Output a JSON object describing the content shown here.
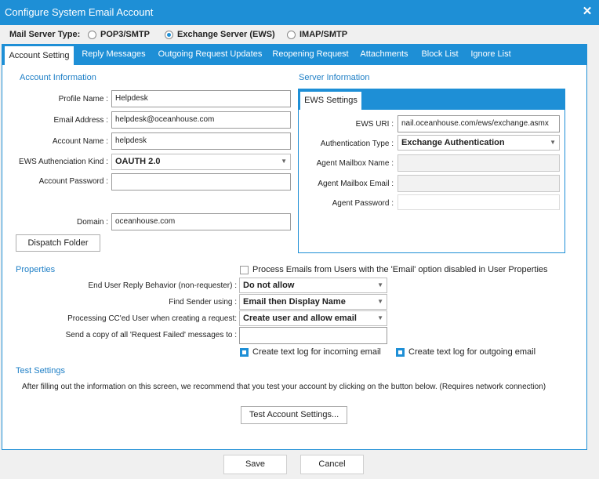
{
  "window": {
    "title": "Configure System Email Account"
  },
  "mail_server": {
    "label": "Mail Server Type:",
    "options": [
      "POP3/SMTP",
      "Exchange Server (EWS)",
      "IMAP/SMTP"
    ],
    "selected": "Exchange Server (EWS)"
  },
  "tabs": [
    "Account Setting",
    "Reply Messages",
    "Outgoing Request Updates",
    "Reopening Request",
    "Attachments",
    "Block List",
    "Ignore List"
  ],
  "account_info": {
    "heading": "Account Information",
    "profile_name_label": "Profile Name :",
    "profile_name": "Helpdesk",
    "email_label": "Email Address :",
    "email": "helpdesk@oceanhouse.com",
    "account_name_label": "Account Name :",
    "account_name": "helpdesk",
    "ews_auth_kind_label": "EWS Authenciation Kind :",
    "ews_auth_kind": "OAUTH 2.0",
    "password_label": "Account Password :",
    "password": "",
    "domain_label": "Domain :",
    "domain": "oceanhouse.com",
    "dispatch_button": "Dispatch Folder"
  },
  "server_info": {
    "heading": "Server Information",
    "tab": "EWS Settings",
    "ews_uri_label": "EWS URI :",
    "ews_uri": "nail.oceanhouse.com/ews/exchange.asmx",
    "auth_type_label": "Authentication Type :",
    "auth_type": "Exchange Authentication",
    "agent_mailbox_name_label": "Agent Mailbox Name :",
    "agent_mailbox_email_label": "Agent Mailbox Email :",
    "agent_password_label": "Agent Password :"
  },
  "properties": {
    "heading": "Properties",
    "process_emails_label": "Process Emails from Users with the 'Email' option disabled in User Properties",
    "reply_behavior_label": "End User Reply Behavior (non-requester) :",
    "reply_behavior": "Do not allow",
    "find_sender_label": "Find Sender using :",
    "find_sender": "Email then Display Name",
    "cc_user_label": "Processing CC'ed User when creating a request:",
    "cc_user": "Create user and allow email",
    "copy_failed_label": "Send a copy of all 'Request Failed' messages to :",
    "copy_failed": "",
    "log_incoming_label": "Create text log for incoming email",
    "log_outgoing_label": "Create text log for outgoing email"
  },
  "test": {
    "heading": "Test Settings",
    "description": "After filling out the information on this screen, we recommend that you test your account by clicking on the button below. (Requires network connection)",
    "button": "Test Account Settings..."
  },
  "footer": {
    "save": "Save",
    "cancel": "Cancel"
  },
  "colors": {
    "accent": "#1e8fd6",
    "section": "#1e7fc6"
  },
  "icons": {
    "close": "close-icon",
    "caret": "chevron-down-icon"
  }
}
